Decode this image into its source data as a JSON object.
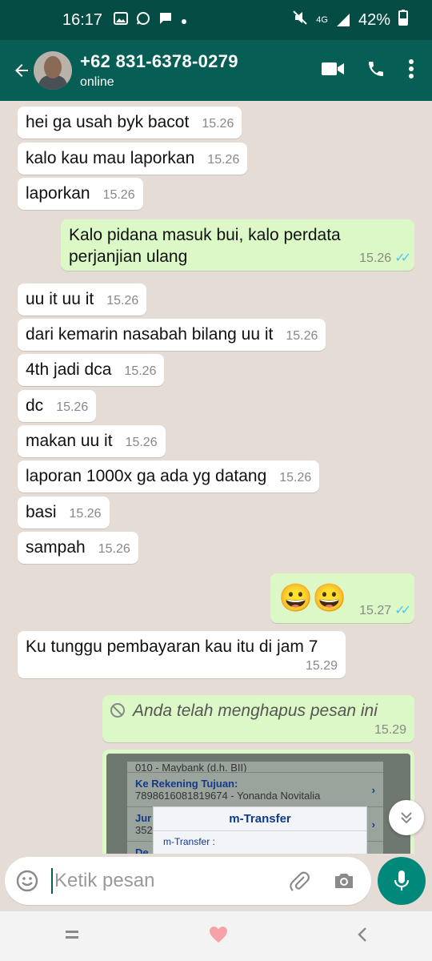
{
  "status_bar": {
    "time": "16:17",
    "battery": "42%",
    "network": "4G"
  },
  "header": {
    "contact_name": "+62 831-6378-0279",
    "contact_status": "online"
  },
  "messages": [
    {
      "dir": "in",
      "text": "hei ga usah byk bacot",
      "time": "15.26"
    },
    {
      "dir": "in",
      "text": "kalo kau mau laporkan",
      "time": "15.26"
    },
    {
      "dir": "in",
      "text": "laporkan",
      "time": "15.26"
    },
    {
      "dir": "out",
      "text_line1": "Kalo pidana masuk bui, kalo perdata",
      "text_line2": "perjanjian ulang",
      "time": "15.26",
      "status": "read"
    },
    {
      "dir": "in",
      "text": "uu it uu it",
      "time": "15.26"
    },
    {
      "dir": "in",
      "text": "dari kemarin nasabah bilang uu it",
      "time": "15.26"
    },
    {
      "dir": "in",
      "text": "4th jadi dca",
      "time": "15.26"
    },
    {
      "dir": "in",
      "text": "dc",
      "time": "15.26"
    },
    {
      "dir": "in",
      "text": "makan uu it",
      "time": "15.26"
    },
    {
      "dir": "in",
      "text": "laporan 1000x ga ada yg datang",
      "time": "15.26"
    },
    {
      "dir": "in",
      "text": "basi",
      "time": "15.26"
    },
    {
      "dir": "in",
      "text": "sampah",
      "time": "15.26"
    },
    {
      "dir": "out",
      "text": "😀😀",
      "time": "15.27",
      "status": "read"
    },
    {
      "dir": "in",
      "text": "Ku tunggu pembayaran kau itu di jam 7",
      "time": "15.29"
    },
    {
      "dir": "out",
      "text": "Anda telah menghapus pesan ini",
      "time": "15.29",
      "deleted": true
    }
  ],
  "image_message": {
    "row1": "010 - Maybank (d.h. BII)",
    "row2_label": "Ke Rekening Tujuan:",
    "row2_value": "7898616081819674 - Yonanda Novitalia",
    "row3_label": "Jur",
    "row3_value": "352",
    "row4_label": "De",
    "modal_title": "m-Transfer",
    "modal_sub": "m-Transfer :"
  },
  "input": {
    "placeholder": "Ketik pesan"
  },
  "colors": {
    "header": "#075e54",
    "statusbar": "#054d44",
    "outgoing": "#dcf8c6",
    "incoming": "#ffffff",
    "mic": "#00897b",
    "read_ticks": "#4fc3f7"
  }
}
